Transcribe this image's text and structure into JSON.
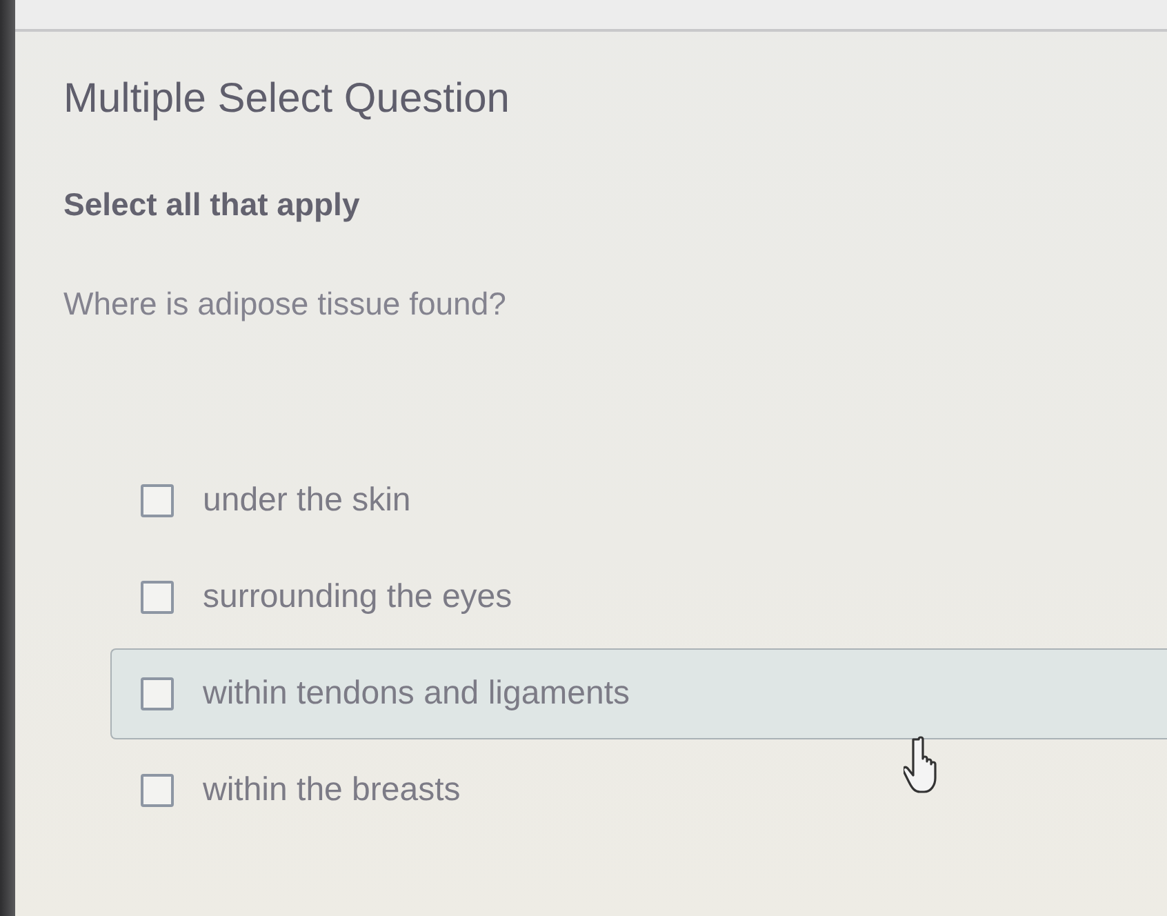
{
  "question_type": "Multiple Select Question",
  "instruction": "Select all that apply",
  "question": "Where is adipose tissue found?",
  "options": [
    {
      "label": "under the skin",
      "checked": false,
      "hovered": false
    },
    {
      "label": "surrounding the eyes",
      "checked": false,
      "hovered": false
    },
    {
      "label": "within tendons and ligaments",
      "checked": false,
      "hovered": true
    },
    {
      "label": "within the breasts",
      "checked": false,
      "hovered": false
    }
  ]
}
